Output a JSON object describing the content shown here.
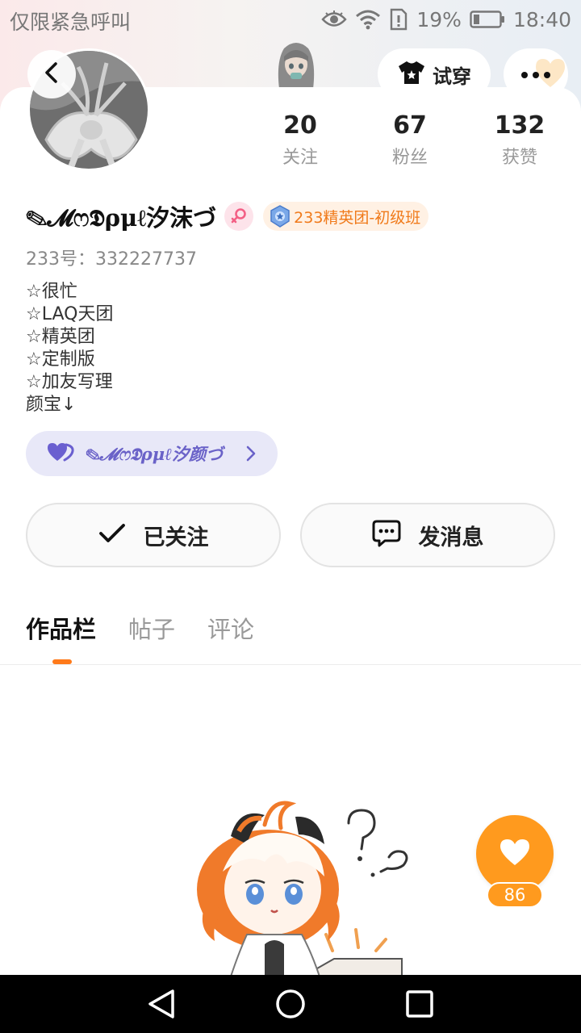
{
  "status_bar": {
    "carrier_text": "仅限紧急呼叫",
    "battery_percent": "19%",
    "time": "18:40",
    "icons": [
      "eye-icon",
      "wifi-icon",
      "sim-alert-icon",
      "battery-icon"
    ]
  },
  "header": {
    "back_icon": "chevron-left-icon",
    "tryon_label": "试穿",
    "tryon_icon": "tshirt-icon",
    "more_icon": "ellipsis-icon"
  },
  "profile": {
    "username": "✎𝓜ෆ𝕯ρμℓ汐沫づ",
    "gender": "female",
    "group_badge": "233精英团-初级班",
    "uid_text": "233号：332227737",
    "stats": {
      "following": {
        "value": "20",
        "label": "关注"
      },
      "followers": {
        "value": "67",
        "label": "粉丝"
      },
      "likes": {
        "value": "132",
        "label": "获赞"
      }
    },
    "bio_lines": [
      "☆很忙",
      "☆LAQ天团",
      "☆精英团",
      "☆定制版",
      "☆加友写理",
      "颜宝↓"
    ],
    "linked_partner": "✎𝓜ෆ𝕯ρμℓ汐颜づ"
  },
  "actions": {
    "follow_label": "已关注",
    "message_label": "发消息"
  },
  "tabs": [
    {
      "label": "作品栏",
      "active": true
    },
    {
      "label": "帖子",
      "active": false
    },
    {
      "label": "评论",
      "active": false
    }
  ],
  "like_fab": {
    "count": "86"
  },
  "colors": {
    "accent_orange": "#ff9a1e",
    "tab_indicator": "#ff7a1a",
    "partner_purple": "#6a62c8",
    "group_badge_text": "#f07a1a"
  }
}
